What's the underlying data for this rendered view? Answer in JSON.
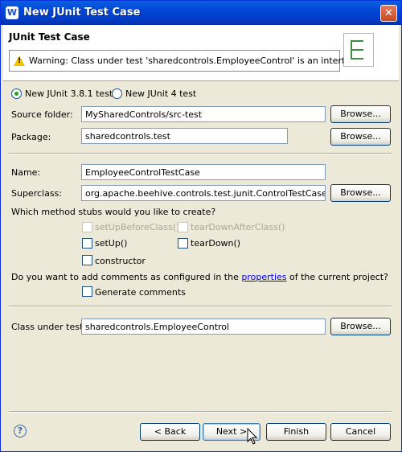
{
  "window": {
    "title": "New JUnit Test Case",
    "close": "✕",
    "app_icon": "W"
  },
  "header": {
    "title": "JUnit Test Case",
    "warning": "Warning: Class under test 'sharedcontrols.EmployeeControl' is an interface."
  },
  "version": {
    "options": [
      "New JUnit 3.8.1 test",
      "New JUnit 4 test"
    ],
    "selected": "New JUnit 3.8.1 test"
  },
  "source_folder": {
    "label": "Source folder:",
    "value": "MySharedControls/src-test",
    "browse": "Browse..."
  },
  "package": {
    "label": "Package:",
    "value": "sharedcontrols.test",
    "browse": "Browse..."
  },
  "name": {
    "label": "Name:",
    "value": "EmployeeControlTestCase"
  },
  "superclass": {
    "label": "Superclass:",
    "value": "org.apache.beehive.controls.test.junit.ControlTestCase",
    "browse": "Browse..."
  },
  "stubs": {
    "question": "Which method stubs would you like to create?",
    "setUpBeforeClass": "setUpBeforeClass()",
    "tearDownAfterClass": "tearDownAfterClass()",
    "setUp": "setUp()",
    "tearDown": "tearDown()",
    "constructor": "constructor"
  },
  "comments": {
    "question_before": "Do you want to add comments as configured in the ",
    "link": "properties",
    "question_after": " of the current project?",
    "generate": "Generate comments"
  },
  "class_under_test": {
    "label": "Class under test:",
    "value": "sharedcontrols.EmployeeControl",
    "browse": "Browse..."
  },
  "footer": {
    "help": "?",
    "back": "< Back",
    "next": "Next >",
    "finish": "Finish",
    "cancel": "Cancel"
  },
  "colors": {
    "titlebar": "#0046d5",
    "dialog_bg": "#ece9d8",
    "radio_dot": "#21a121",
    "link": "#0000ff"
  }
}
